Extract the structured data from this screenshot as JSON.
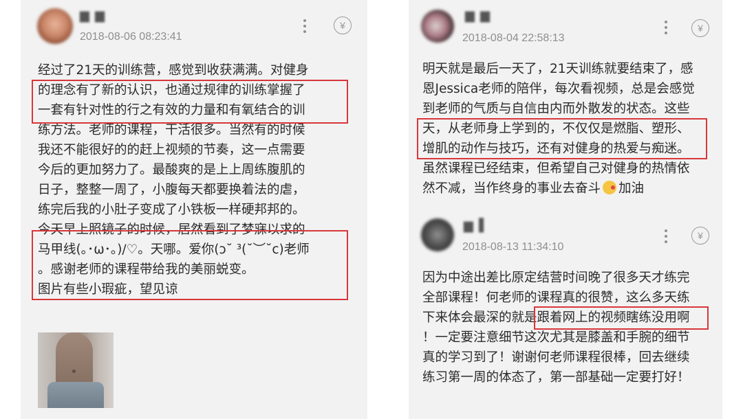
{
  "left": {
    "comment": {
      "username": "▆ ▆",
      "timestamp": "2018-08-06 08:23:41",
      "tip_symbol": "¥",
      "lines": [
        "经过了21天的训练营，感觉到收获满满。对健身",
        "的理念有了新的认识，也通过规律的训练掌握了",
        "一套有针对性的行之有效的力量和有氧结合的训",
        "练方法。老师的课程，干活很多。当然有的时候",
        "我还不能很好的的赶上视频的节奏，这一点需要",
        "今后的更加努力了。最酸爽的是上上周练腹肌的",
        "日子，整整一周了，小腹每天都要换着法的虐，",
        "练完后我的小肚子变成了小铁板一样硬邦邦的。",
        "今天早上照镜子的时候，居然看到了梦寐以求的",
        "马甲线(｡･ω･｡)/♡。天哪。爱你(ↄ˘ ³(˘︶˘c)老师",
        "。感谢老师的课程带给我的美丽蜕变。",
        "图片有些小瑕疵，望见谅"
      ]
    }
  },
  "right": {
    "comment1": {
      "username": "▆ ▆",
      "timestamp": "2018-08-04 22:58:13",
      "tip_symbol": "¥",
      "lines": [
        "明天就是最后一天了，21天训练就要结束了，感",
        "恩Jessica老师的陪伴，每次看视频，总是会感觉",
        "到老师的气质与自信由内而外散发的状态。这些",
        "天，从老师身上学到的，不仅仅是燃脂、塑形、",
        "增肌的动作与技巧，还有对健身的热爱与痴迷。",
        "虽然课程已经结束，但希望自己对健身的热情依"
      ],
      "last_line_before": "然不减，当作终身的事业去奋斗",
      "last_line_after": "加油"
    },
    "comment2": {
      "username": "▆ ▌",
      "timestamp": "2018-08-13 11:34:10",
      "tip_symbol": "¥",
      "lines": [
        "因为中途出差比原定结营时间晚了很多天才练完",
        "全部课程！何老师的课程真的很赞，这么多天练",
        "下来体会最深的就是跟着网上的视频瞎练没用啊",
        "！一定要注意细节这次尤其是膝盖和手腕的细节",
        "真的学习到了！谢谢何老师课程很棒，回去继续",
        "练习第一周的体态了，第一部基础一定要打好！"
      ]
    }
  },
  "colors": {
    "highlight": "#d8363a",
    "card_bg": "#f2f2f2",
    "timestamp": "#8e8e8e"
  }
}
